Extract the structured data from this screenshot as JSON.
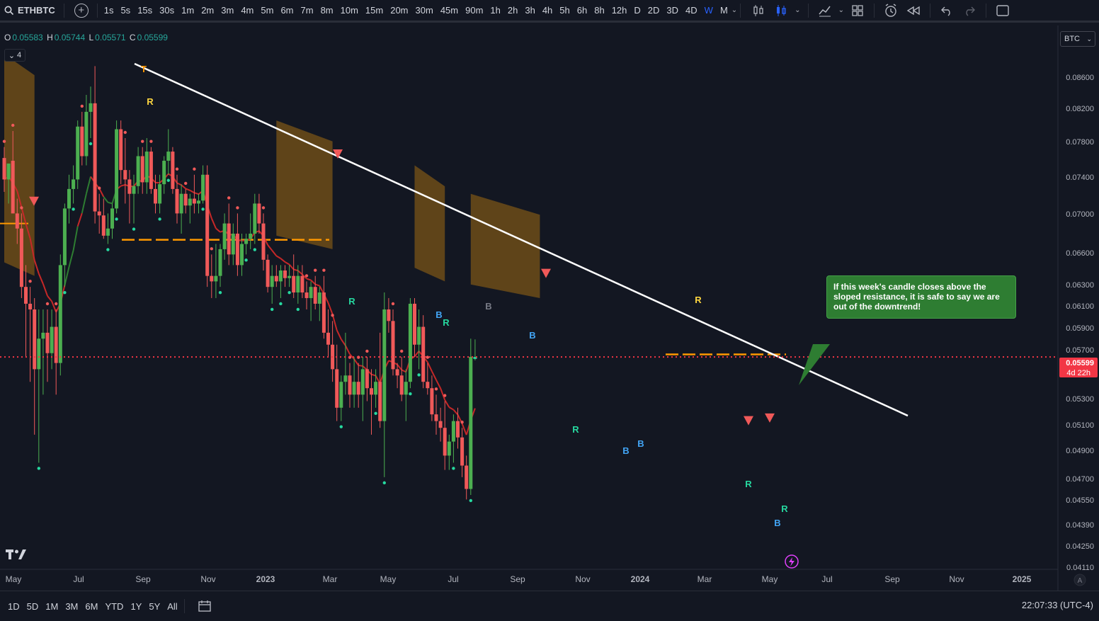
{
  "toolbar": {
    "symbol": "ETHBTC",
    "intervals": [
      "1s",
      "5s",
      "15s",
      "30s",
      "1m",
      "2m",
      "3m",
      "4m",
      "5m",
      "6m",
      "7m",
      "8m",
      "10m",
      "15m",
      "20m",
      "30m",
      "45m",
      "90m",
      "1h",
      "2h",
      "3h",
      "4h",
      "5h",
      "6h",
      "8h",
      "12h",
      "D",
      "2D",
      "3D",
      "4D",
      "W",
      "M"
    ],
    "active_interval": "W",
    "icons": [
      "candles-icon",
      "bars-compare-icon",
      "indicators-icon",
      "layout-icon",
      "alert-clock-icon",
      "replay-icon",
      "undo-icon",
      "redo-icon",
      "fullscreen-icon"
    ]
  },
  "legend": {
    "open_label": "O",
    "open": "0.05583",
    "high_label": "H",
    "high": "0.05744",
    "low_label": "L",
    "low": "0.05571",
    "close_label": "C",
    "close": "0.05599",
    "indicator_count": "4"
  },
  "currency": "BTC",
  "price_axis": {
    "ticks": [
      "0.08600",
      "0.08200",
      "0.07800",
      "0.07400",
      "0.07000",
      "0.06600",
      "0.06300",
      "0.06100",
      "0.05900",
      "0.05700",
      "0.05300",
      "0.05100",
      "0.04900",
      "0.04700",
      "0.04550",
      "0.04390",
      "0.04250",
      "0.04110"
    ],
    "last_price": "0.05599",
    "countdown": "4d 22h"
  },
  "time_axis": {
    "ticks": [
      "May",
      "Jul",
      "Sep",
      "Nov",
      "2023",
      "Mar",
      "May",
      "Jul",
      "Sep",
      "Nov",
      "2024",
      "Mar",
      "May",
      "Jul",
      "Sep",
      "Nov",
      "2025"
    ],
    "bold_ticks": [
      "2023",
      "2024",
      "2025"
    ]
  },
  "annotation": {
    "text": "If this week's candle closes above the sloped resistance, it is safe to say we are out of the downtrend!"
  },
  "signal_labels": [
    "T",
    "R",
    "R",
    "B",
    "R",
    "B",
    "B",
    "R",
    "B",
    "B",
    "R",
    "R",
    "R",
    "B"
  ],
  "bottom": {
    "ranges": [
      "1D",
      "5D",
      "1M",
      "3M",
      "6M",
      "YTD",
      "1Y",
      "5Y",
      "All"
    ],
    "clock": "22:07:33 (UTC-4)"
  },
  "colors": {
    "up": "#4caf50",
    "down": "#f05959",
    "resistance": "#ffffff",
    "cloud": "#7a5417",
    "support": "#ff9800",
    "last_price": "#f23645",
    "accent": "#2962ff"
  },
  "chart_data": {
    "type": "candlestick",
    "title": "",
    "symbol": "ETHBTC",
    "timeframe": "W",
    "y_scale": "log",
    "ylim": [
      0.0411,
      0.0875
    ],
    "x_range": [
      "2022-05",
      "2025-01"
    ],
    "last": {
      "open": 0.05583,
      "high": 0.05744,
      "low": 0.05571,
      "close": 0.05599
    },
    "candles": [
      {
        "o": 0.0748,
        "h": 0.076,
        "l": 0.0712,
        "c": 0.0725
      },
      {
        "o": 0.0725,
        "h": 0.0735,
        "l": 0.07,
        "c": 0.0742
      },
      {
        "o": 0.0745,
        "h": 0.0778,
        "l": 0.069,
        "c": 0.069
      },
      {
        "o": 0.069,
        "h": 0.0705,
        "l": 0.066,
        "c": 0.0675
      },
      {
        "o": 0.0675,
        "h": 0.069,
        "l": 0.061,
        "c": 0.062
      },
      {
        "o": 0.062,
        "h": 0.064,
        "l": 0.056,
        "c": 0.0605
      },
      {
        "o": 0.0605,
        "h": 0.062,
        "l": 0.054,
        "c": 0.06
      },
      {
        "o": 0.06,
        "h": 0.061,
        "l": 0.05,
        "c": 0.055
      },
      {
        "o": 0.055,
        "h": 0.06,
        "l": 0.048,
        "c": 0.0575
      },
      {
        "o": 0.0575,
        "h": 0.06,
        "l": 0.053,
        "c": 0.058
      },
      {
        "o": 0.058,
        "h": 0.06,
        "l": 0.054,
        "c": 0.0563
      },
      {
        "o": 0.0563,
        "h": 0.06,
        "l": 0.055,
        "c": 0.0585
      },
      {
        "o": 0.0585,
        "h": 0.06,
        "l": 0.053,
        "c": 0.0555
      },
      {
        "o": 0.0555,
        "h": 0.065,
        "l": 0.0545,
        "c": 0.064
      },
      {
        "o": 0.064,
        "h": 0.07,
        "l": 0.062,
        "c": 0.0695
      },
      {
        "o": 0.0695,
        "h": 0.073,
        "l": 0.068,
        "c": 0.0715
      },
      {
        "o": 0.0715,
        "h": 0.074,
        "l": 0.07,
        "c": 0.0725
      },
      {
        "o": 0.0725,
        "h": 0.079,
        "l": 0.0715,
        "c": 0.0783
      },
      {
        "o": 0.0783,
        "h": 0.08,
        "l": 0.074,
        "c": 0.075
      },
      {
        "o": 0.075,
        "h": 0.082,
        "l": 0.074,
        "c": 0.08
      },
      {
        "o": 0.08,
        "h": 0.083,
        "l": 0.077,
        "c": 0.081
      },
      {
        "o": 0.081,
        "h": 0.0855,
        "l": 0.068,
        "c": 0.0692
      },
      {
        "o": 0.0692,
        "h": 0.071,
        "l": 0.067,
        "c": 0.0688
      },
      {
        "o": 0.0688,
        "h": 0.0705,
        "l": 0.0665,
        "c": 0.0668
      },
      {
        "o": 0.0668,
        "h": 0.069,
        "l": 0.066,
        "c": 0.0675
      },
      {
        "o": 0.0675,
        "h": 0.07,
        "l": 0.0665,
        "c": 0.0695
      },
      {
        "o": 0.0695,
        "h": 0.079,
        "l": 0.069,
        "c": 0.078
      },
      {
        "o": 0.078,
        "h": 0.079,
        "l": 0.072,
        "c": 0.0735
      },
      {
        "o": 0.0735,
        "h": 0.077,
        "l": 0.07,
        "c": 0.0725
      },
      {
        "o": 0.0725,
        "h": 0.0735,
        "l": 0.068,
        "c": 0.071
      },
      {
        "o": 0.071,
        "h": 0.073,
        "l": 0.068,
        "c": 0.0718
      },
      {
        "o": 0.0718,
        "h": 0.076,
        "l": 0.071,
        "c": 0.075
      },
      {
        "o": 0.075,
        "h": 0.076,
        "l": 0.071,
        "c": 0.0722
      },
      {
        "o": 0.0722,
        "h": 0.077,
        "l": 0.071,
        "c": 0.0755
      },
      {
        "o": 0.0755,
        "h": 0.076,
        "l": 0.071,
        "c": 0.0715
      },
      {
        "o": 0.0715,
        "h": 0.073,
        "l": 0.069,
        "c": 0.07
      },
      {
        "o": 0.07,
        "h": 0.073,
        "l": 0.069,
        "c": 0.072
      },
      {
        "o": 0.072,
        "h": 0.075,
        "l": 0.071,
        "c": 0.0745
      },
      {
        "o": 0.0745,
        "h": 0.078,
        "l": 0.073,
        "c": 0.0755
      },
      {
        "o": 0.0755,
        "h": 0.076,
        "l": 0.071,
        "c": 0.0715
      },
      {
        "o": 0.0715,
        "h": 0.073,
        "l": 0.068,
        "c": 0.069
      },
      {
        "o": 0.069,
        "h": 0.072,
        "l": 0.067,
        "c": 0.071
      },
      {
        "o": 0.071,
        "h": 0.0715,
        "l": 0.069,
        "c": 0.0698
      },
      {
        "o": 0.0698,
        "h": 0.071,
        "l": 0.068,
        "c": 0.0705
      },
      {
        "o": 0.0705,
        "h": 0.073,
        "l": 0.069,
        "c": 0.07
      },
      {
        "o": 0.07,
        "h": 0.071,
        "l": 0.069,
        "c": 0.0703
      },
      {
        "o": 0.0703,
        "h": 0.074,
        "l": 0.07,
        "c": 0.073
      },
      {
        "o": 0.073,
        "h": 0.074,
        "l": 0.062,
        "c": 0.063
      },
      {
        "o": 0.063,
        "h": 0.065,
        "l": 0.061,
        "c": 0.0625
      },
      {
        "o": 0.0625,
        "h": 0.066,
        "l": 0.061,
        "c": 0.063
      },
      {
        "o": 0.063,
        "h": 0.066,
        "l": 0.062,
        "c": 0.0655
      },
      {
        "o": 0.0655,
        "h": 0.069,
        "l": 0.0645,
        "c": 0.068
      },
      {
        "o": 0.068,
        "h": 0.07,
        "l": 0.064,
        "c": 0.065
      },
      {
        "o": 0.065,
        "h": 0.068,
        "l": 0.064,
        "c": 0.067
      },
      {
        "o": 0.067,
        "h": 0.069,
        "l": 0.063,
        "c": 0.064
      },
      {
        "o": 0.064,
        "h": 0.067,
        "l": 0.063,
        "c": 0.066
      },
      {
        "o": 0.066,
        "h": 0.067,
        "l": 0.065,
        "c": 0.0665
      },
      {
        "o": 0.0665,
        "h": 0.069,
        "l": 0.0655,
        "c": 0.067
      },
      {
        "o": 0.067,
        "h": 0.071,
        "l": 0.066,
        "c": 0.07
      },
      {
        "o": 0.07,
        "h": 0.071,
        "l": 0.067,
        "c": 0.068
      },
      {
        "o": 0.068,
        "h": 0.069,
        "l": 0.0635,
        "c": 0.0645
      },
      {
        "o": 0.0645,
        "h": 0.065,
        "l": 0.0615,
        "c": 0.062
      },
      {
        "o": 0.062,
        "h": 0.064,
        "l": 0.0605,
        "c": 0.063
      },
      {
        "o": 0.063,
        "h": 0.064,
        "l": 0.062,
        "c": 0.0625
      },
      {
        "o": 0.0625,
        "h": 0.064,
        "l": 0.061,
        "c": 0.0635
      },
      {
        "o": 0.0635,
        "h": 0.064,
        "l": 0.062,
        "c": 0.0628
      },
      {
        "o": 0.0628,
        "h": 0.064,
        "l": 0.062,
        "c": 0.063
      },
      {
        "o": 0.063,
        "h": 0.065,
        "l": 0.061,
        "c": 0.0615
      },
      {
        "o": 0.0615,
        "h": 0.064,
        "l": 0.0605,
        "c": 0.063
      },
      {
        "o": 0.063,
        "h": 0.064,
        "l": 0.061,
        "c": 0.0615
      },
      {
        "o": 0.0615,
        "h": 0.0625,
        "l": 0.06,
        "c": 0.061
      },
      {
        "o": 0.061,
        "h": 0.0625,
        "l": 0.059,
        "c": 0.062
      },
      {
        "o": 0.062,
        "h": 0.063,
        "l": 0.06,
        "c": 0.0605
      },
      {
        "o": 0.0605,
        "h": 0.062,
        "l": 0.059,
        "c": 0.0615
      },
      {
        "o": 0.0615,
        "h": 0.063,
        "l": 0.0575,
        "c": 0.058
      },
      {
        "o": 0.058,
        "h": 0.06,
        "l": 0.056,
        "c": 0.057
      },
      {
        "o": 0.057,
        "h": 0.059,
        "l": 0.054,
        "c": 0.055
      },
      {
        "o": 0.055,
        "h": 0.057,
        "l": 0.051,
        "c": 0.052
      },
      {
        "o": 0.052,
        "h": 0.0545,
        "l": 0.051,
        "c": 0.054
      },
      {
        "o": 0.054,
        "h": 0.058,
        "l": 0.053,
        "c": 0.0545
      },
      {
        "o": 0.0545,
        "h": 0.0555,
        "l": 0.052,
        "c": 0.053
      },
      {
        "o": 0.053,
        "h": 0.056,
        "l": 0.052,
        "c": 0.054
      },
      {
        "o": 0.054,
        "h": 0.0555,
        "l": 0.052,
        "c": 0.053
      },
      {
        "o": 0.053,
        "h": 0.056,
        "l": 0.051,
        "c": 0.055
      },
      {
        "o": 0.055,
        "h": 0.056,
        "l": 0.0525,
        "c": 0.0535
      },
      {
        "o": 0.0535,
        "h": 0.055,
        "l": 0.05,
        "c": 0.053
      },
      {
        "o": 0.053,
        "h": 0.055,
        "l": 0.052,
        "c": 0.054
      },
      {
        "o": 0.054,
        "h": 0.058,
        "l": 0.0505,
        "c": 0.051
      },
      {
        "o": 0.051,
        "h": 0.0615,
        "l": 0.047,
        "c": 0.06
      },
      {
        "o": 0.06,
        "h": 0.061,
        "l": 0.058,
        "c": 0.059
      },
      {
        "o": 0.059,
        "h": 0.06,
        "l": 0.0545,
        "c": 0.055
      },
      {
        "o": 0.055,
        "h": 0.0555,
        "l": 0.0535,
        "c": 0.0545
      },
      {
        "o": 0.0545,
        "h": 0.056,
        "l": 0.0525,
        "c": 0.053
      },
      {
        "o": 0.053,
        "h": 0.055,
        "l": 0.051,
        "c": 0.054
      },
      {
        "o": 0.054,
        "h": 0.061,
        "l": 0.0535,
        "c": 0.0605
      },
      {
        "o": 0.0605,
        "h": 0.061,
        "l": 0.056,
        "c": 0.057
      },
      {
        "o": 0.057,
        "h": 0.06,
        "l": 0.055,
        "c": 0.0585
      },
      {
        "o": 0.0585,
        "h": 0.0595,
        "l": 0.0535,
        "c": 0.054
      },
      {
        "o": 0.054,
        "h": 0.0555,
        "l": 0.053,
        "c": 0.0535
      },
      {
        "o": 0.0535,
        "h": 0.0545,
        "l": 0.051,
        "c": 0.0515
      },
      {
        "o": 0.0515,
        "h": 0.053,
        "l": 0.05,
        "c": 0.051
      },
      {
        "o": 0.051,
        "h": 0.052,
        "l": 0.0495,
        "c": 0.0505
      },
      {
        "o": 0.0505,
        "h": 0.0525,
        "l": 0.0475,
        "c": 0.0485
      },
      {
        "o": 0.0485,
        "h": 0.05,
        "l": 0.0475,
        "c": 0.0495
      },
      {
        "o": 0.0495,
        "h": 0.0515,
        "l": 0.048,
        "c": 0.051
      },
      {
        "o": 0.051,
        "h": 0.052,
        "l": 0.049,
        "c": 0.0498
      },
      {
        "o": 0.0498,
        "h": 0.0505,
        "l": 0.047,
        "c": 0.0478
      },
      {
        "o": 0.0478,
        "h": 0.0485,
        "l": 0.0455,
        "c": 0.0462
      },
      {
        "o": 0.0462,
        "h": 0.0575,
        "l": 0.0458,
        "c": 0.056
      },
      {
        "o": 0.05583,
        "h": 0.05744,
        "l": 0.05571,
        "c": 0.05599
      }
    ]
  }
}
